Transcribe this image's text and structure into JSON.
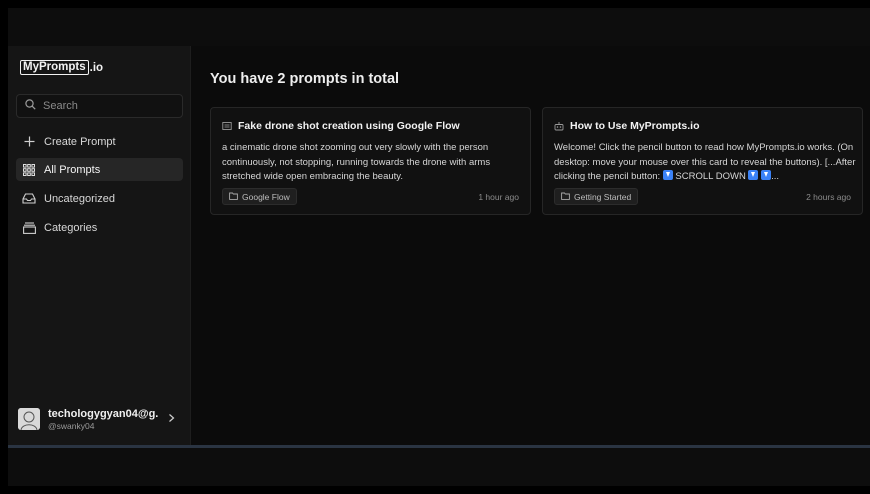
{
  "app": {
    "logo_box_text": "MyPrompts",
    "logo_suffix": ".io"
  },
  "search": {
    "placeholder": "Search",
    "value": ""
  },
  "sidebar": {
    "items": [
      {
        "label": "Create Prompt",
        "icon": "plus-icon"
      },
      {
        "label": "All Prompts",
        "icon": "grid-icon",
        "active": true
      },
      {
        "label": "Uncategorized",
        "icon": "inbox-icon"
      },
      {
        "label": "Categories",
        "icon": "folder-stack-icon"
      }
    ]
  },
  "user": {
    "name": "techologygyan04@g...",
    "handle": "@swanky04"
  },
  "main": {
    "title": "You have 2 prompts in total"
  },
  "cards": [
    {
      "title": "Fake drone shot creation using Google Flow",
      "body": "a cinematic drone shot zooming out very slowly with the person continuously, not stopping, running towards the drone with arms stretched wide open embracing the beauty.",
      "tag": "Google Flow",
      "time": "1 hour ago"
    },
    {
      "title": "How to Use MyPrompts.io",
      "body_part1": "Welcome! Click the pencil button to read how MyPrompts.io works. (On desktop: move your mouse over this card to reveal the buttons). [...After clicking the pencil button: ",
      "body_part2": " SCROLL DOWN ",
      "body_part3": "...",
      "tag": "Getting Started",
      "time": "2 hours ago"
    }
  ],
  "colors": {
    "accent_emoji": "#3b82f6",
    "active_nav_bg": "#262626"
  }
}
